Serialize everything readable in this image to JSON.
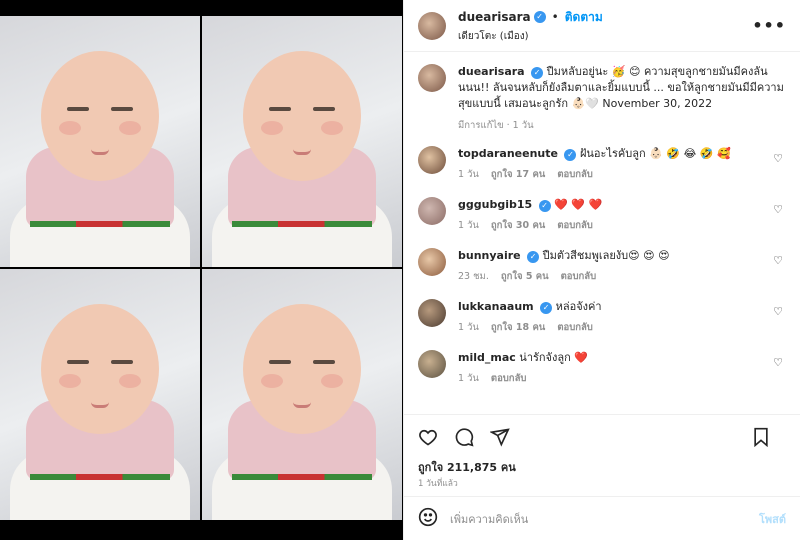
{
  "header": {
    "username": "duearisara",
    "follow_label": "ติดตาม",
    "location": "เดียวโตะ (เมือง)",
    "more_icon": "more-horizontal-icon"
  },
  "caption": {
    "username": "duearisara",
    "text": "ปืมหลับอยู่นะ 🥳 😊 ความสุขลูกชายมันมีคงลันนนน!! ลันจนหลับก็ยังลืมตาและยิ้มแบบนี้ ... ขอให้ลูกชายมันมีมีความสุขแบบนี้ เสมอนะลูกรัก 👶🏻🤍 November 30, 2022",
    "edited": "มีการแก้ไข",
    "time": "1 วัน"
  },
  "comments": [
    {
      "username": "topdaraneenute",
      "verified": true,
      "text": "ฝันอะไรคับลูก 👶🏻 🤣 😂 🤣 🥰",
      "time": "1 วัน",
      "likes": "ถูกใจ 17 คน",
      "reply": "ตอบกลับ"
    },
    {
      "username": "gggubgib15",
      "verified": true,
      "text": "❤️ ❤️ ❤️",
      "time": "1 วัน",
      "likes": "ถูกใจ 30 คน",
      "reply": "ตอบกลับ"
    },
    {
      "username": "bunnyaire",
      "verified": true,
      "text": "ปืมตัวสีชมพูเลยงับ😍 😍 😍",
      "time": "23 ชม.",
      "likes": "ถูกใจ 5 คน",
      "reply": "ตอบกลับ"
    },
    {
      "username": "lukkanaaum",
      "verified": true,
      "text": "หล่อจังค่า",
      "time": "1 วัน",
      "likes": "ถูกใจ 18 คน",
      "reply": "ตอบกลับ"
    },
    {
      "username": "mild_mac",
      "verified": false,
      "text": "น่ารักจังลูก ❤️",
      "time": "1 วัน",
      "likes": "",
      "reply": "ตอบกลับ"
    }
  ],
  "actions": {
    "like_icon": "heart-icon",
    "comment_icon": "comment-icon",
    "share_icon": "send-icon",
    "save_icon": "bookmark-icon"
  },
  "likes_label": "ถูกใจ 211,875 คน",
  "posted_ago": "1 วันที่แล้ว",
  "add_comment": {
    "placeholder": "เพิ่มความคิดเห็น",
    "post_label": "โพสต์",
    "emoji_icon": "emoji-icon"
  },
  "colors": {
    "link_blue": "#0095f6",
    "verified_blue": "#3897f0",
    "like_red": "#ed4956",
    "post_disabled": "#b2dffc"
  }
}
